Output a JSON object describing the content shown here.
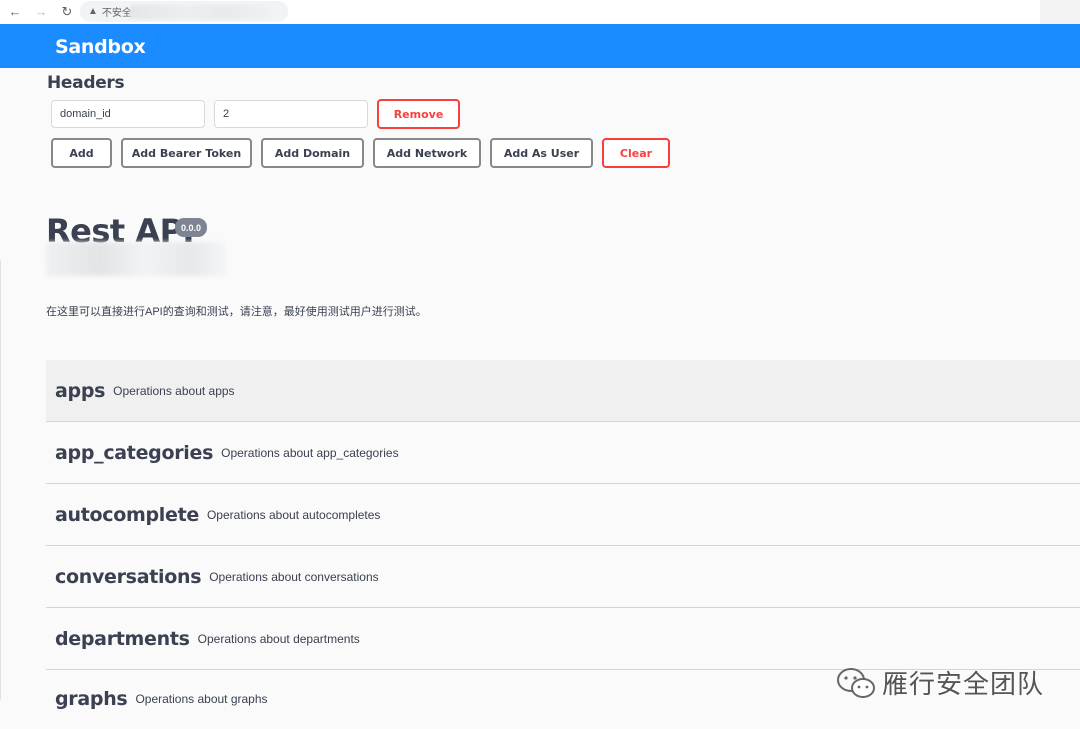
{
  "browser": {
    "security_label": "不安全"
  },
  "topbar": {
    "title": "Sandbox"
  },
  "headers": {
    "title": "Headers",
    "key_value": "domain_id",
    "value_value": "2",
    "remove_label": "Remove",
    "buttons": {
      "add": "Add",
      "add_bearer_token": "Add Bearer Token",
      "add_domain": "Add Domain",
      "add_network": "Add Network",
      "add_as_user": "Add As User",
      "clear": "Clear"
    }
  },
  "info": {
    "title": "Rest API",
    "version": "0.0.0",
    "description": "在这里可以直接进行API的查询和测试，请注意，最好使用测试用户进行测试。"
  },
  "tags": [
    {
      "name": "apps",
      "description": "Operations about apps"
    },
    {
      "name": "app_categories",
      "description": "Operations about app_categories"
    },
    {
      "name": "autocomplete",
      "description": "Operations about autocompletes"
    },
    {
      "name": "conversations",
      "description": "Operations about conversations"
    },
    {
      "name": "departments",
      "description": "Operations about departments"
    },
    {
      "name": "graphs",
      "description": "Operations about graphs"
    }
  ],
  "watermark": {
    "text": "雁行安全团队"
  },
  "colors": {
    "topbar": "#1a8cff",
    "danger": "#f93e3e",
    "text": "#3b4151",
    "badge": "#7d8492"
  }
}
